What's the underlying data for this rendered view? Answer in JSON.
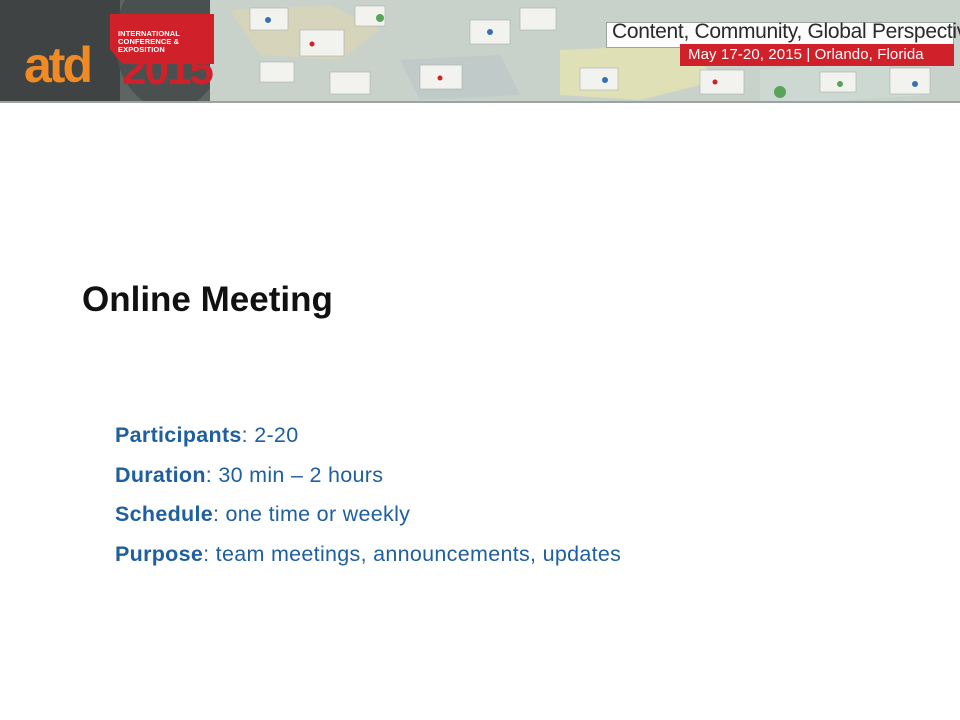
{
  "banner": {
    "logo_sub_line1": "International",
    "logo_sub_line2": "Conference & Exposition",
    "logo_atd": "atd",
    "logo_year": "2015",
    "tagline": "Content, Community, Global Perspectives",
    "dates": "May 17-20, 2015 | Orlando, Florida",
    "colors": {
      "brand_red": "#d0212a",
      "brand_orange": "#f08a24"
    }
  },
  "slide": {
    "title": "Online Meeting",
    "bullets": [
      {
        "term": "Participants",
        "text": ": 2-20"
      },
      {
        "term": "Duration",
        "text": ": 30 min – 2 hours"
      },
      {
        "term": "Schedule",
        "text": ": one time or weekly"
      },
      {
        "term": "Purpose",
        "text": ": team meetings, announcements, updates"
      }
    ],
    "colors": {
      "bullet_text": "#1f5fa0",
      "title_text": "#111111"
    }
  }
}
